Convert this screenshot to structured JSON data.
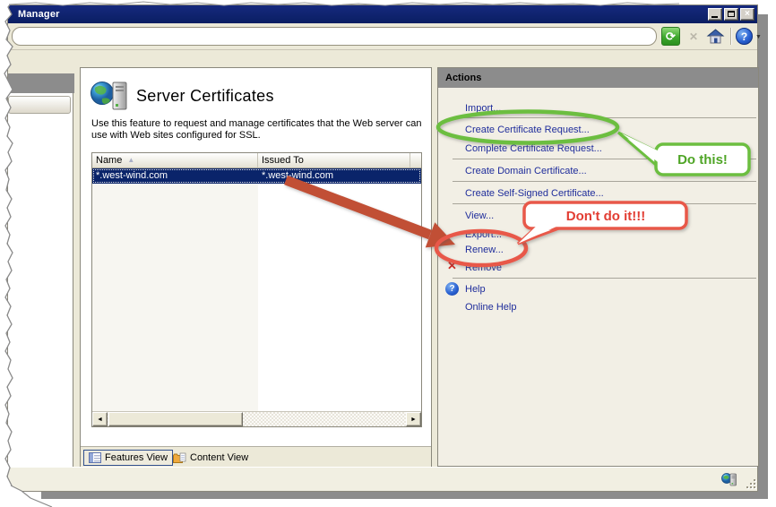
{
  "window": {
    "title": "Manager"
  },
  "toolbar": {
    "address_value": "",
    "refresh_label": "refresh",
    "stop_label": "stop",
    "home_label": "home",
    "help_label": "help"
  },
  "icons": {
    "refresh_glyph": "⟳",
    "stop_glyph": "✕",
    "help_glyph": "?",
    "close_glyph": "×",
    "caret_glyph": "▼",
    "sort_asc_glyph": "▲",
    "remove_glyph": "✕",
    "scroll_left_glyph": "◄",
    "scroll_right_glyph": "►"
  },
  "feature": {
    "title": "Server Certificates",
    "description": "Use this feature to request and manage certificates that the Web server can use with Web sites configured for SSL."
  },
  "table": {
    "columns": [
      "Name",
      "Issued To"
    ],
    "sort": {
      "column": "Name",
      "direction": "ascending"
    },
    "rows": [
      {
        "name": "*.west-wind.com",
        "issued_to": "*.west-wind.com",
        "selected": true
      }
    ]
  },
  "view_tabs": {
    "features": "Features View",
    "content": "Content View",
    "selected": "Features View"
  },
  "actions": {
    "header": "Actions",
    "items": [
      {
        "label": "Import..."
      },
      {
        "label": "Create Certificate Request..."
      },
      {
        "label": "Complete Certificate Request..."
      },
      {
        "label": "Create Domain Certificate..."
      },
      {
        "label": "Create Self-Signed Certificate..."
      },
      {
        "label": "View..."
      },
      {
        "label": "Export..."
      },
      {
        "label": "Renew..."
      },
      {
        "label": "Remove"
      },
      {
        "label": "Help"
      },
      {
        "label": "Online Help"
      }
    ]
  },
  "annotations": {
    "do_this": {
      "text": "Do this!",
      "text_color": "#4FA527",
      "border_color": "#6CBE3F"
    },
    "dont_do_it": {
      "text": "Don't do it!!!",
      "text_color": "#E23C33",
      "border_color": "#E8594A"
    },
    "arrow_color": "#C14F35"
  },
  "colors": {
    "titlebar": "#0E2167",
    "selection": "#0A246A",
    "panel_bg": "#ECE9D8",
    "actions_bg": "#F2EFE5",
    "actions_header_bg": "#8C8C8C",
    "link": "#1F2D9B"
  }
}
